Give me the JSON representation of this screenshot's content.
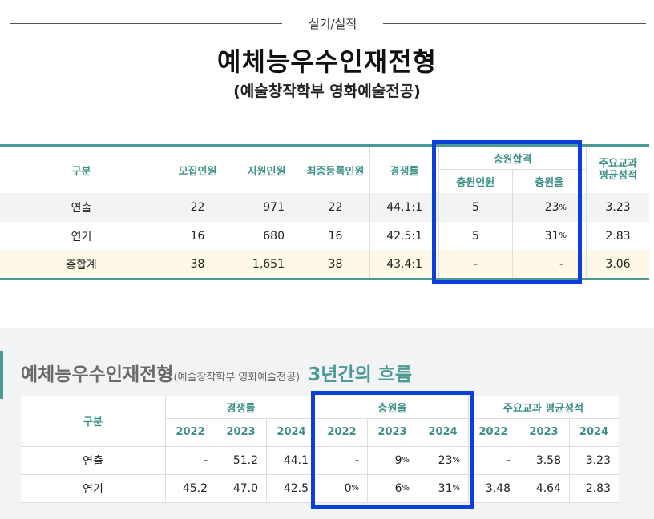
{
  "header": {
    "section_label": "실기/실적",
    "title": "예체능우수인재전형",
    "subtitle": "(예술창작학부 영화예술전공)"
  },
  "table1": {
    "headers": {
      "category": "구분",
      "recruit": "모집인원",
      "applicants": "지원인원",
      "final_registered": "최종등록인원",
      "competition": "경쟁률",
      "additional_group": "충원합격",
      "additional_count": "충원인원",
      "additional_rate": "충원율",
      "gpa": "주요교과\n평균성적"
    },
    "rows": [
      {
        "name": "연출",
        "recruit": "22",
        "applicants": "971",
        "final": "22",
        "competition": "44.1:1",
        "add_count": "5",
        "add_rate": "23",
        "gpa": "3.23"
      },
      {
        "name": "연기",
        "recruit": "16",
        "applicants": "680",
        "final": "16",
        "competition": "42.5:1",
        "add_count": "5",
        "add_rate": "31",
        "gpa": "2.83"
      },
      {
        "name": "총합계",
        "recruit": "38",
        "applicants": "1,651",
        "final": "38",
        "competition": "43.4:1",
        "add_count": "-",
        "add_rate": "-",
        "gpa": "3.06"
      }
    ],
    "percent_unit": "%"
  },
  "trend": {
    "title_main": "예체능우수인재전형",
    "title_small": "(예술창작학부 영화예술전공)",
    "title_accent": "3년간의 흐름",
    "headers": {
      "category": "구분",
      "competition": "경쟁률",
      "additional_rate": "충원율",
      "gpa": "주요교과 평균성적"
    },
    "years": [
      "2022",
      "2023",
      "2024"
    ],
    "rows": [
      {
        "name": "연출",
        "competition": [
          "-",
          "51.2",
          "44.1"
        ],
        "add_rate": [
          "-",
          "9",
          "23"
        ],
        "gpa": [
          "-",
          "3.58",
          "3.23"
        ]
      },
      {
        "name": "연기",
        "competition": [
          "45.2",
          "47.0",
          "42.5"
        ],
        "add_rate": [
          "0",
          "6",
          "31"
        ],
        "gpa": [
          "3.48",
          "4.64",
          "2.83"
        ]
      }
    ]
  },
  "colors": {
    "accent_teal": "#4c9a94",
    "highlight_blue": "#0a40d9"
  }
}
